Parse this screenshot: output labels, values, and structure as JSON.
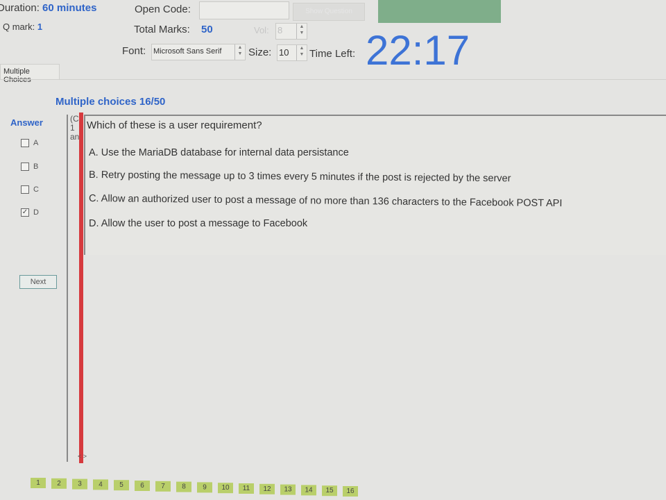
{
  "header": {
    "duration_label": "Duration:",
    "duration_value": "60 minutes",
    "qmark_label": "Q mark:",
    "qmark_value": "1",
    "open_code_label": "Open Code:",
    "open_code_value": "",
    "show_question_label": "Show Question",
    "total_marks_label": "Total Marks:",
    "total_marks_value": "50",
    "vol_label": "Vol:",
    "vol_value": "8",
    "font_label": "Font:",
    "font_value": "Microsoft Sans Serif",
    "size_label": "Size:",
    "size_value": "10",
    "time_left_label": "Time Left:",
    "time_left_value": "22:17",
    "accent_color": "#3d73d6"
  },
  "tabs": [
    {
      "label": "Multiple Choices"
    }
  ],
  "section": {
    "title": "Multiple choices 16/50"
  },
  "answer": {
    "title": "Answer",
    "options": [
      {
        "label": "A",
        "checked": false
      },
      {
        "label": "B",
        "checked": false
      },
      {
        "label": "C",
        "checked": false
      },
      {
        "label": "D",
        "checked": true
      }
    ],
    "next_label": "Next"
  },
  "hint": {
    "lines": [
      "(Cl",
      "1",
      "an"
    ]
  },
  "question": {
    "text": "Which of these is a user requirement?",
    "options": [
      "A. Use the MariaDB database for internal data persistance",
      "B. Retry posting the message up to 3 times every 5 minutes if the post is rejected by the server",
      "C. Allow an authorized user to post a message of no more than 136 characters to the Facebook POST API",
      "D. Allow the user to post a message to Facebook"
    ]
  },
  "scroll_arrows": "< >",
  "question_numbers": [
    "1",
    "2",
    "3",
    "4",
    "5",
    "6",
    "7",
    "8",
    "9",
    "10",
    "11",
    "12",
    "13",
    "14",
    "15",
    "16"
  ]
}
